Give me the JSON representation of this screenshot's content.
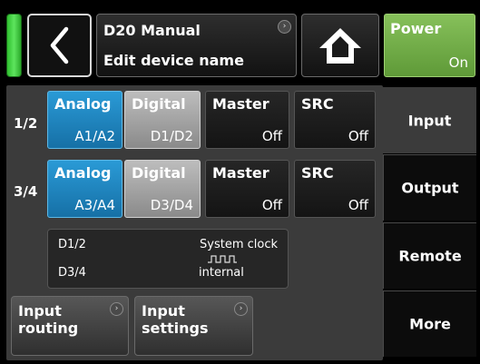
{
  "header": {
    "back_icon": "chevron-left-icon",
    "title": "D20 Manual",
    "subtitle": "Edit device name",
    "info_icon": "info-circle-icon",
    "home_icon": "home-icon",
    "power": {
      "label": "Power",
      "state": "On",
      "color": "#6aa844"
    },
    "status_color": "#43d143"
  },
  "rows": [
    {
      "label": "1/2",
      "analog": {
        "title": "Analog",
        "value": "A1/A2",
        "selected": true
      },
      "digital": {
        "title": "Digital",
        "value": "D1/D2",
        "selected": false
      },
      "master": {
        "title": "Master",
        "value": "Off"
      },
      "src": {
        "title": "SRC",
        "value": "Off"
      }
    },
    {
      "label": "3/4",
      "analog": {
        "title": "Analog",
        "value": "A3/A4",
        "selected": true
      },
      "digital": {
        "title": "Digital",
        "value": "D3/D4",
        "selected": false
      },
      "master": {
        "title": "Master",
        "value": "Off"
      },
      "src": {
        "title": "SRC",
        "value": "Off"
      }
    }
  ],
  "clock": {
    "d12": "D1/2",
    "d34": "D3/4",
    "label": "System clock",
    "icon": "clock-waveform-icon",
    "source": "internal"
  },
  "bottom_buttons": [
    {
      "line1": "Input",
      "line2": "routing"
    },
    {
      "line1": "Input",
      "line2": "settings"
    }
  ],
  "tabs": [
    {
      "label": "Input",
      "active": true
    },
    {
      "label": "Output",
      "active": false
    },
    {
      "label": "Remote",
      "active": false
    },
    {
      "label": "More",
      "active": false
    }
  ]
}
